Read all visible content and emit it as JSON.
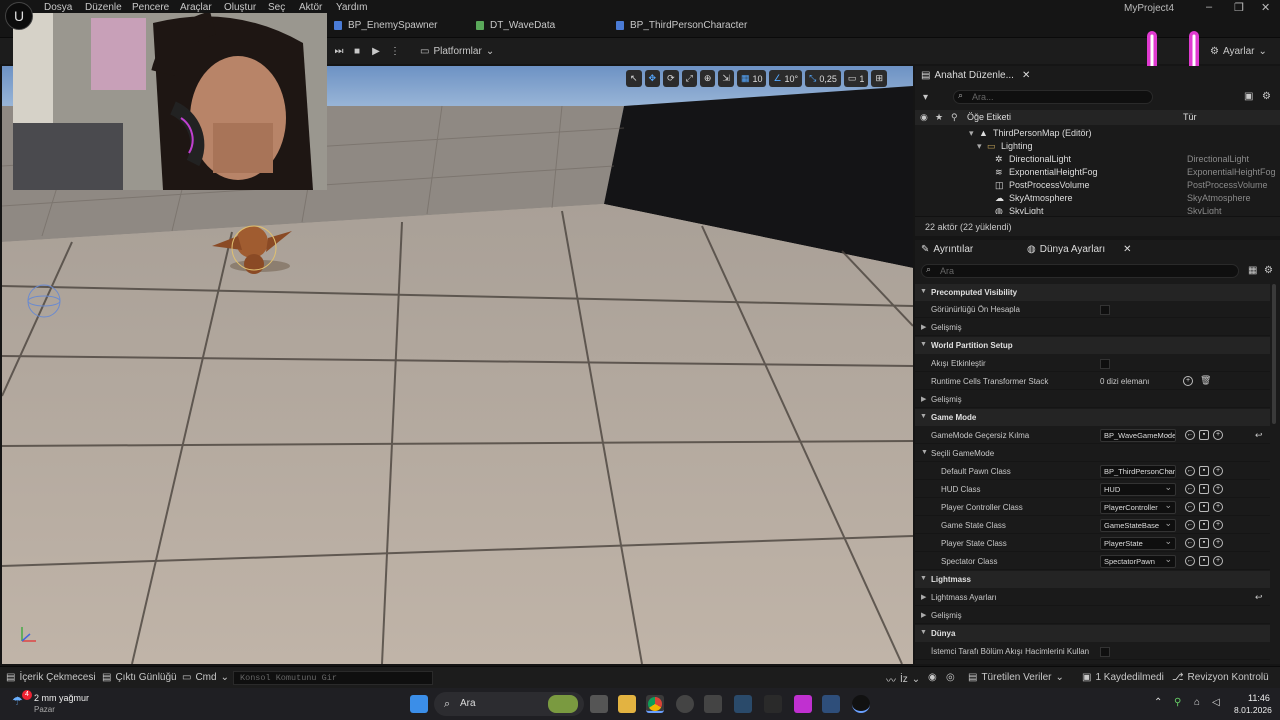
{
  "menu": {
    "items": [
      "Dosya",
      "Düzenle",
      "Pencere",
      "Araçlar",
      "Oluştur",
      "Seç",
      "Aktör",
      "Yardım"
    ],
    "project_title": "MyProject4"
  },
  "tabs": {
    "items": [
      "BP_EnemySpawner",
      "DT_WaveData",
      "BP_ThirdPersonCharacter"
    ]
  },
  "toolbar": {
    "platforms_label": "Platformlar",
    "settings_label": "Ayarlar"
  },
  "viewport": {
    "grid_size": "10",
    "rotation_snap": "10°",
    "scale_snap": "0,25",
    "camera_speed": "1"
  },
  "outliner": {
    "tab_title": "Anahat Düzenle...",
    "search_placeholder": "Ara...",
    "col_label": "Öğe Etiketi",
    "col_type": "Tür",
    "rows": [
      {
        "label": "ThirdPersonMap (Editör)",
        "type": ""
      },
      {
        "label": "Lighting",
        "type": ""
      },
      {
        "label": "DirectionalLight",
        "type": "DirectionalLight"
      },
      {
        "label": "ExponentialHeightFog",
        "type": "ExponentialHeightFog"
      },
      {
        "label": "PostProcessVolume",
        "type": "PostProcessVolume"
      },
      {
        "label": "SkyAtmosphere",
        "type": "SkyAtmosphere"
      },
      {
        "label": "SkyLight",
        "type": "SkyLight"
      }
    ],
    "footer": "22 aktör (22 yüklendi)"
  },
  "details": {
    "tab_details": "Ayrıntılar",
    "tab_world": "Dünya Ayarları",
    "search_placeholder": "Ara",
    "sections": {
      "precomputed": "Precomputed Visibility",
      "world_partition": "World Partition Setup",
      "game_mode": "Game Mode",
      "lightmass": "Lightmass",
      "world": "Dünya"
    },
    "props": {
      "precompute_visibility": "Görünürlüğü Ön Hesapla",
      "advanced": "Gelişmiş",
      "enable_streaming": "Akışı Etkinleştir",
      "runtime_cells": "Runtime Cells Transformer Stack",
      "runtime_cells_value": "0 dizi elemanı",
      "gamemode_override": "GameMode Geçersiz Kılma",
      "gamemode_override_value": "BP_WaveGameMode",
      "selected_gamemode": "Seçili GameMode",
      "default_pawn": "Default Pawn Class",
      "default_pawn_value": "BP_ThirdPersonCharacter",
      "hud": "HUD Class",
      "hud_value": "HUD",
      "player_controller": "Player Controller Class",
      "player_controller_value": "PlayerController",
      "game_state": "Game State Class",
      "game_state_value": "GameStateBase",
      "player_state": "Player State Class",
      "player_state_value": "PlayerState",
      "spectator": "Spectator Class",
      "spectator_value": "SpectatorPawn",
      "lightmass_settings": "Lightmass Ayarları",
      "client_side_streaming": "İstemci Tarafı Bölüm Akışı Hacimlerini Kullan"
    }
  },
  "statusbar": {
    "content_drawer": "İçerik Çekmecesi",
    "output_log": "Çıktı Günlüğü",
    "cmd": "Cmd",
    "console_placeholder": "Konsol Komutunu Gir",
    "iz": "İz",
    "derived_data": "Türetilen Veriler",
    "unsaved": "1 Kaydedilmedi",
    "revision": "Revizyon Kontrolü"
  },
  "taskbar": {
    "weather_temp": "2 mm yağmur",
    "weather_day": "Pazar",
    "search_label": "Ara",
    "time": "11:46",
    "date": "8.01.2026",
    "notif_count": "4"
  }
}
